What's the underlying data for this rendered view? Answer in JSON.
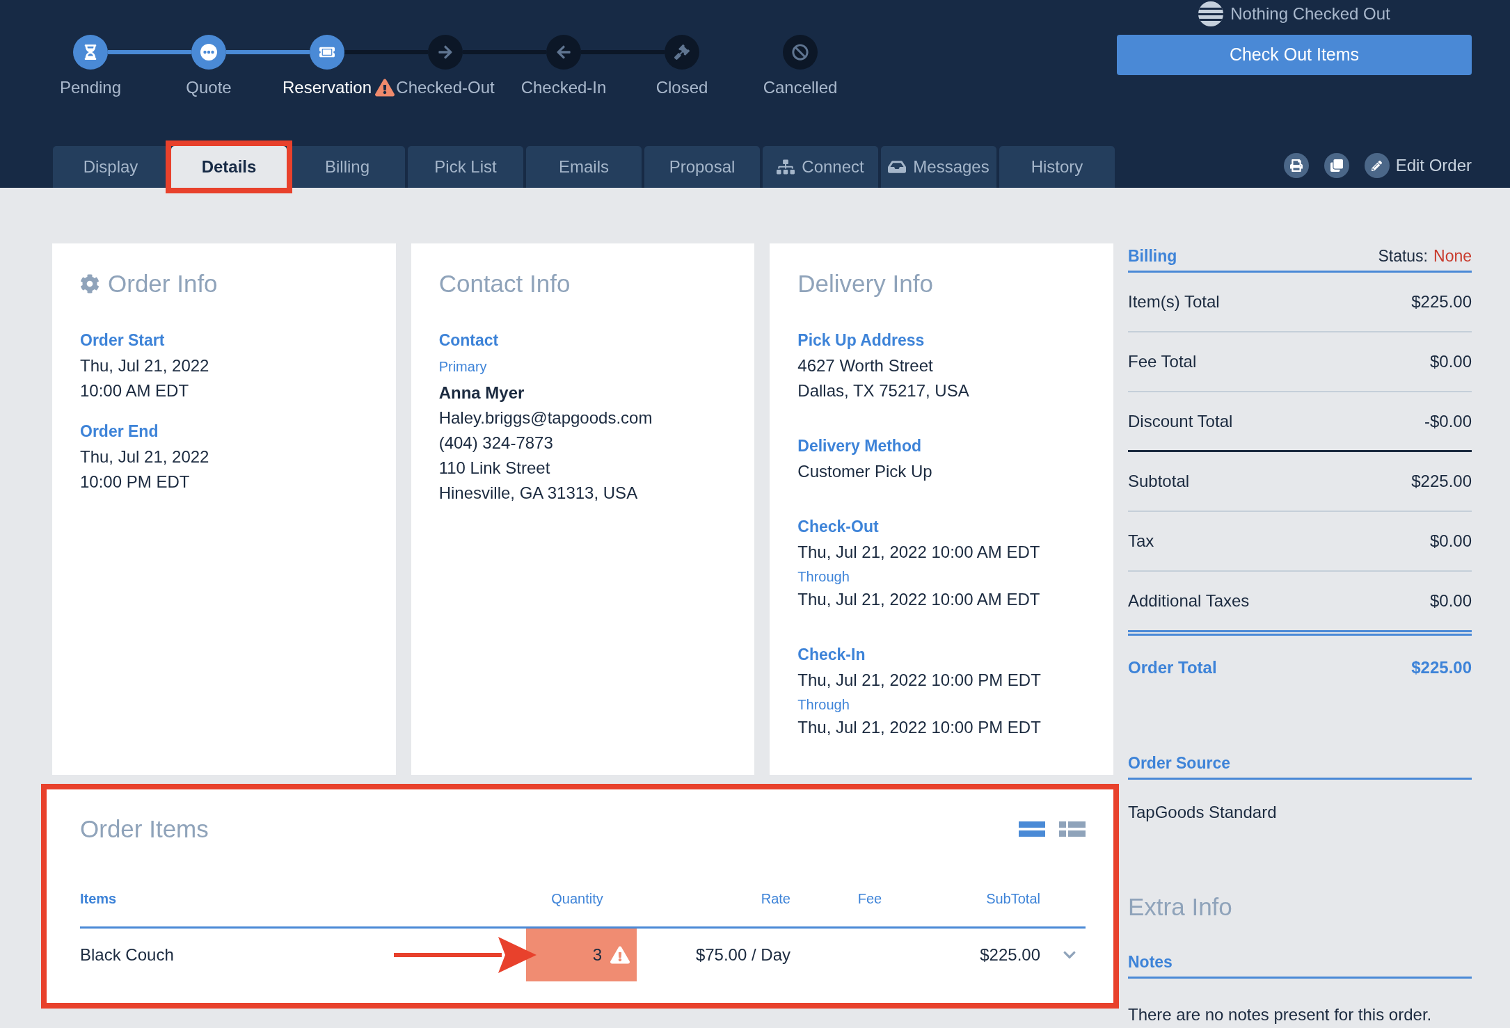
{
  "stepper": {
    "steps": [
      {
        "label": "Pending",
        "reached": true,
        "current": false,
        "warning": false
      },
      {
        "label": "Quote",
        "reached": true,
        "current": false,
        "warning": false
      },
      {
        "label": "Reservation",
        "reached": true,
        "current": true,
        "warning": true
      },
      {
        "label": "Checked-Out",
        "reached": false,
        "current": false,
        "warning": false
      },
      {
        "label": "Checked-In",
        "reached": false,
        "current": false,
        "warning": false
      },
      {
        "label": "Closed",
        "reached": false,
        "current": false,
        "warning": false
      }
    ],
    "cancel_step": {
      "label": "Cancelled",
      "reached": false,
      "current": false
    }
  },
  "checkout": {
    "status": "Nothing Checked Out",
    "button": "Check Out Items"
  },
  "tabs": [
    {
      "label": "Display",
      "selected": false,
      "annotated": false
    },
    {
      "label": "Details",
      "selected": true,
      "annotated": true
    },
    {
      "label": "Billing",
      "selected": false,
      "annotated": false
    },
    {
      "label": "Pick List",
      "selected": false,
      "annotated": false
    },
    {
      "label": "Emails",
      "selected": false,
      "annotated": false
    },
    {
      "label": "Proposal",
      "selected": false,
      "annotated": false
    },
    {
      "label": "Connect",
      "selected": false,
      "annotated": false
    },
    {
      "label": "Messages",
      "selected": false,
      "annotated": false
    },
    {
      "label": "History",
      "selected": false,
      "annotated": false
    }
  ],
  "toolbar": {
    "edit_label": "Edit Order"
  },
  "order_info": {
    "title": "Order Info",
    "fields": [
      {
        "label": "Order Start",
        "lines": [
          "Thu, Jul 21, 2022",
          "10:00 AM EDT"
        ]
      },
      {
        "label": "Order End",
        "lines": [
          "Thu, Jul 21, 2022",
          "10:00 PM EDT"
        ]
      }
    ]
  },
  "contact_info": {
    "title": "Contact Info",
    "label": "Contact",
    "role": "Primary",
    "name": "Anna Myer",
    "lines": [
      "Haley.briggs@tapgoods.com",
      "(404) 324-7873",
      "110 Link Street",
      "Hinesville, GA 31313, USA"
    ]
  },
  "delivery_info": {
    "title": "Delivery Info",
    "sections": [
      {
        "kind": "text",
        "label": "Pick Up Address",
        "lines": [
          "4627 Worth Street",
          "Dallas, TX 75217, USA"
        ]
      },
      {
        "kind": "text",
        "label": "Delivery Method",
        "lines": [
          "Customer Pick Up"
        ]
      },
      {
        "kind": "range",
        "label": "Check-Out",
        "start": "Thu, Jul 21, 2022 10:00 AM EDT",
        "through": "Through",
        "end": "Thu, Jul 21, 2022 10:00 AM EDT"
      },
      {
        "kind": "range",
        "label": "Check-In",
        "start": "Thu, Jul 21, 2022 10:00 PM EDT",
        "through": "Through",
        "end": "Thu, Jul 21, 2022 10:00 PM EDT"
      }
    ]
  },
  "order_items": {
    "title": "Order Items",
    "annotated": true,
    "views": [
      {
        "selected": true
      },
      {
        "selected": false
      }
    ],
    "columns": [
      "Items",
      "Quantity",
      "Rate",
      "Fee",
      "SubTotal"
    ],
    "rows": [
      {
        "item": "Black Couch",
        "quantity": "3",
        "quantity_warning": true,
        "annotated": true,
        "rate": "$75.00 / Day",
        "subtotal": "$225.00",
        "expanded": false
      }
    ]
  },
  "billing": {
    "title": "Billing",
    "status_label": "Status:",
    "status_value": "None",
    "groups": [
      {
        "rows": [
          {
            "label": "Item(s) Total",
            "value": "$225.00"
          },
          {
            "label": "Fee Total",
            "value": "$0.00"
          },
          {
            "label": "Discount Total",
            "value": "-$0.00"
          }
        ]
      },
      {
        "rows": [
          {
            "label": "Subtotal",
            "value": "$225.00"
          },
          {
            "label": "Tax",
            "value": "$0.00"
          },
          {
            "label": "Additional Taxes",
            "value": "$0.00"
          }
        ]
      }
    ],
    "total": {
      "label": "Order Total",
      "value": "$225.00"
    }
  },
  "order_source": {
    "title": "Order Source",
    "value": "TapGoods Standard"
  },
  "extra_info": {
    "title": "Extra Info",
    "notes_label": "Notes",
    "notes": "There are no notes present for this order."
  }
}
